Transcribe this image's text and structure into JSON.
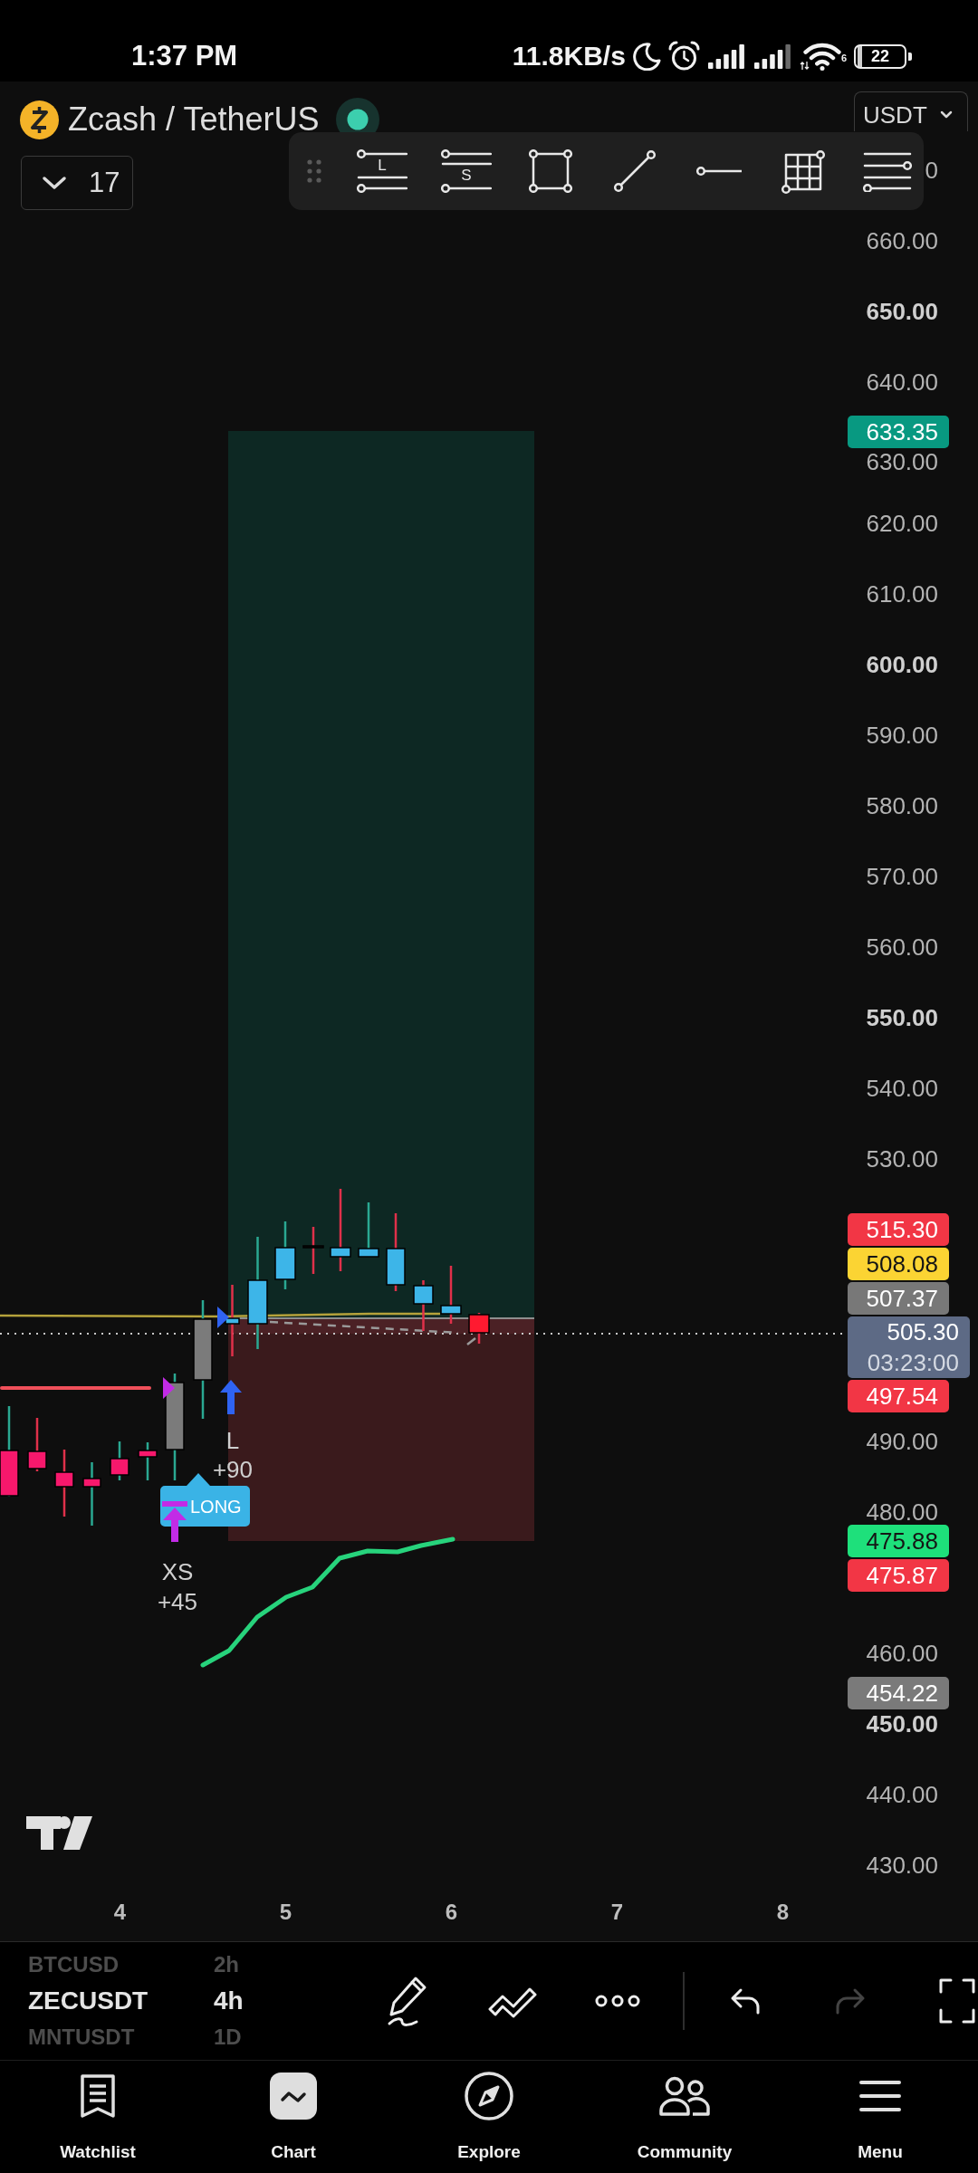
{
  "status_bar": {
    "time": "1:37 PM",
    "network_speed": "11.8KB/s",
    "wifi_generation": "6",
    "battery": "22"
  },
  "header": {
    "symbol": "Zcash / TetherUS",
    "currency": "USDT",
    "legend_count": "17"
  },
  "drawing_toolbar": [
    {
      "kind": "long_position",
      "letter": "L"
    },
    {
      "kind": "short_position",
      "letter": "S"
    },
    {
      "kind": "rectangle"
    },
    {
      "kind": "trend_line"
    },
    {
      "kind": "horizontal_ray"
    },
    {
      "kind": "grid"
    },
    {
      "kind": "parallel_lines"
    }
  ],
  "price_axis": [
    {
      "label": "0",
      "bold": false
    },
    {
      "label": "660.00",
      "bold": false
    },
    {
      "label": "650.00",
      "bold": true
    },
    {
      "label": "640.00",
      "bold": false
    },
    {
      "label": "630.00",
      "bold": false
    },
    {
      "label": "620.00",
      "bold": false
    },
    {
      "label": "610.00",
      "bold": false
    },
    {
      "label": "600.00",
      "bold": true
    },
    {
      "label": "590.00",
      "bold": false
    },
    {
      "label": "580.00",
      "bold": false
    },
    {
      "label": "570.00",
      "bold": false
    },
    {
      "label": "560.00",
      "bold": false
    },
    {
      "label": "550.00",
      "bold": true
    },
    {
      "label": "540.00",
      "bold": false
    },
    {
      "label": "530.00",
      "bold": false
    },
    {
      "label": "490.00",
      "bold": false
    },
    {
      "label": "480.00",
      "bold": false
    },
    {
      "label": "460.00",
      "bold": false
    },
    {
      "label": "450.00",
      "bold": true
    },
    {
      "label": "440.00",
      "bold": false
    },
    {
      "label": "430.00",
      "bold": false
    }
  ],
  "price_tags": [
    {
      "price": "633.35",
      "color": "#089981"
    },
    {
      "price": "515.30",
      "color": "#f23645"
    },
    {
      "price": "508.08",
      "color": "#fbd433"
    },
    {
      "price": "507.37",
      "color": "#787878"
    },
    {
      "price": "505.30",
      "countdown": "03:23:00",
      "color": "#5d6a85"
    },
    {
      "price": "497.54",
      "color": "#f23645"
    },
    {
      "price": "475.88",
      "color": "#1ee07b"
    },
    {
      "price": "475.87",
      "color": "#f23645"
    },
    {
      "price": "454.22",
      "color": "#7a7a7a"
    }
  ],
  "signals": [
    {
      "kind": "long_entry",
      "label": "L",
      "amount": "+90"
    },
    {
      "kind": "short_exit",
      "label": "XS",
      "amount": "+45"
    }
  ],
  "position_label": "LONG",
  "time_axis": [
    "4",
    "5",
    "6",
    "7",
    "8"
  ],
  "symbol_picker": [
    {
      "symbol": "BTCUSD",
      "interval": "2h",
      "selected": false
    },
    {
      "symbol": "ZECUSDT",
      "interval": "4h",
      "selected": true
    },
    {
      "symbol": "MNTUSDT",
      "interval": "1D",
      "selected": false
    }
  ],
  "chart_toolbar": [
    {
      "kind": "pencil",
      "disabled": false
    },
    {
      "kind": "zigzag",
      "disabled": false
    },
    {
      "kind": "more",
      "disabled": false
    },
    {
      "kind": "undo",
      "disabled": false
    },
    {
      "kind": "redo",
      "disabled": true
    },
    {
      "kind": "fullscreen",
      "disabled": false
    }
  ],
  "bottom_nav": [
    {
      "kind": "watchlist",
      "label": "Watchlist",
      "selected": false
    },
    {
      "kind": "chart",
      "label": "Chart",
      "selected": true
    },
    {
      "kind": "explore",
      "label": "Explore",
      "selected": false
    },
    {
      "kind": "community",
      "label": "Community",
      "selected": false
    },
    {
      "kind": "menu",
      "label": "Menu",
      "selected": false
    }
  ]
}
